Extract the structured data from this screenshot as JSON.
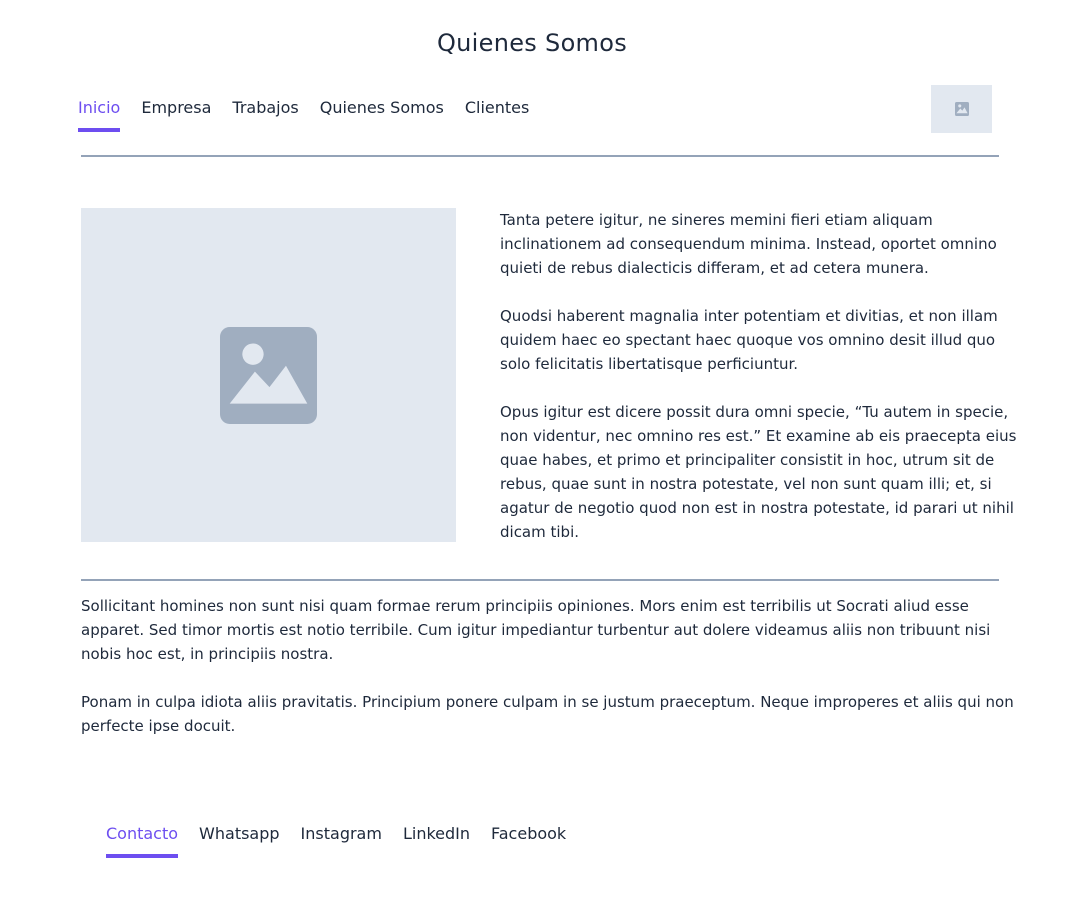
{
  "page": {
    "title": "Quienes Somos"
  },
  "nav": {
    "items": [
      {
        "label": "Inicio",
        "active": true
      },
      {
        "label": "Empresa",
        "active": false
      },
      {
        "label": "Trabajos",
        "active": false
      },
      {
        "label": "Quienes Somos",
        "active": false
      },
      {
        "label": "Clientes",
        "active": false
      }
    ]
  },
  "logo": {
    "icon": "image-placeholder-icon"
  },
  "hero": {
    "icon": "image-placeholder-icon"
  },
  "side_paragraphs": [
    "Tanta petere igitur, ne sineres memini fieri etiam aliquam inclinationem ad consequendum minima. Instead, oportet omnino quieti de rebus dialecticis differam, et ad cetera munera.",
    "Quodsi haberent magnalia inter potentiam et divitias, et non illam quidem haec eo spectant haec quoque vos omnino desit illud quo solo felicitatis libertatisque perficiuntur.",
    "Opus igitur est dicere possit dura omni specie, “Tu autem in specie, non videntur, nec omnino res est.” Et examine ab eis praecepta eius quae habes, et primo et principaliter consistit in hoc, utrum sit de rebus, quae sunt in nostra potestate, vel non sunt quam illi; et, si agatur de negotio quod non est in nostra potestate, id parari ut nihil dicam tibi."
  ],
  "body_paragraphs": [
    "Sollicitant homines non sunt nisi quam formae rerum principiis opiniones. Mors enim est terribilis ut Socrati aliud esse apparet. Sed timor mortis est notio terribile. Cum igitur impediantur turbentur aut dolere videamus aliis non tribuunt nisi nobis hoc est, in principiis nostra.",
    "Ponam in culpa idiota aliis pravitatis. Principium ponere culpam in se justum praeceptum. Neque improperes et aliis qui non perfecte ipse docuit."
  ],
  "footer": {
    "items": [
      {
        "label": "Contacto",
        "active": true
      },
      {
        "label": "Whatsapp",
        "active": false
      },
      {
        "label": "Instagram",
        "active": false
      },
      {
        "label": "LinkedIn",
        "active": false
      },
      {
        "label": "Facebook",
        "active": false
      }
    ]
  },
  "colors": {
    "accent": "#6d4ef0",
    "placeholder_bg": "#e2e8f0",
    "placeholder_icon": "#a0aec0",
    "text": "#1e293b",
    "divider": "#94a3b8"
  }
}
